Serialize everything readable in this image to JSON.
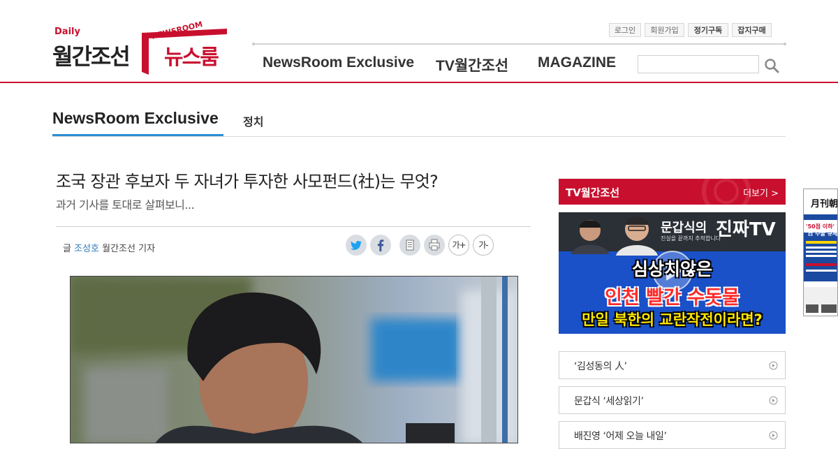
{
  "header": {
    "logo": {
      "daily": "Daily",
      "main": "월간조선",
      "newsroom": "NEWSROOM",
      "red": "뉴스룸"
    },
    "util_links": [
      "로그인",
      "회원가입",
      "정기구독",
      "잡지구매"
    ],
    "nav": [
      "NewsRoom Exclusive",
      "TV월간조선",
      "MAGAZINE"
    ],
    "search": {
      "placeholder": "",
      "icon": "search-icon"
    }
  },
  "section": {
    "title": "NewsRoom Exclusive",
    "tabs": [
      "정치"
    ]
  },
  "article": {
    "title": "조국 장관 후보자 두 자녀가 투자한 사모펀드(社)는 무엇?",
    "subtitle": "과거 기사를 토대로 살펴보니...",
    "byline": {
      "prefix": "글",
      "author": "조성호",
      "org": "월간조선 기자"
    },
    "tools": {
      "twitter_icon": "twitter-icon",
      "facebook_icon": "facebook-icon",
      "copy_icon": "document-icon",
      "print_icon": "print-icon",
      "font_increase": "가+",
      "font_decrease": "가-"
    }
  },
  "sidebar": {
    "tv": {
      "title": "TV월간조선",
      "more": "더보기 >",
      "thumbnail": {
        "show_prefix": "문갑식의",
        "show_name": "진짜TV",
        "show_sub": "진실을 끝까지 추적합니다",
        "line1": "심상치않은",
        "line2": "인천 빨간 수돗물",
        "line3": "만일 북한의 교란작전이라면?"
      }
    },
    "series": [
      "‘김성동의 人’",
      "문갑식 ‘세상읽기’",
      "배진영 ‘어제 오늘 내일’"
    ]
  },
  "magazine": {
    "title": "月刊朝",
    "headlines": [
      "'50점 이하'",
      "'日 수출 규제"
    ]
  },
  "colors": {
    "brand_red": "#c8102e",
    "accent_blue": "#2b8ed3",
    "author_link": "#2b7bbf"
  }
}
